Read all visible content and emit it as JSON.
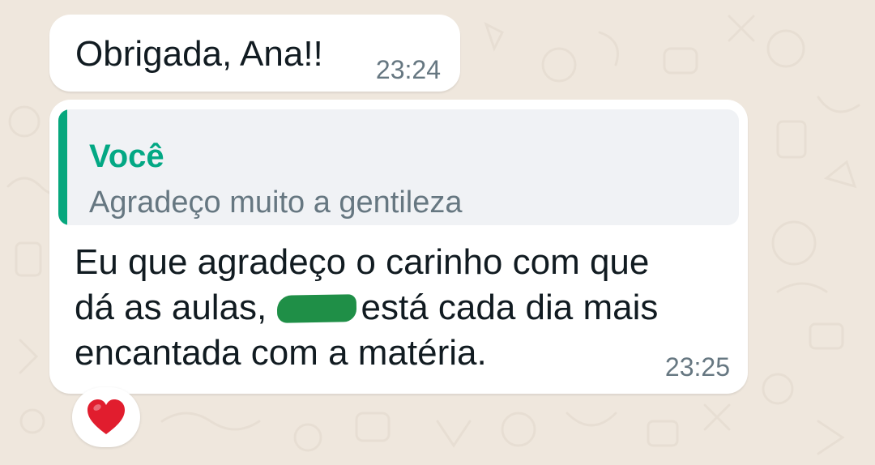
{
  "messages": [
    {
      "text": "Obrigada, Ana!!",
      "time": "23:24"
    },
    {
      "quote": {
        "author": "Você",
        "text": "Agradeço muito a gentileza"
      },
      "text_line1": "Eu que agradeço o carinho com que",
      "text_line2_before": "dá as aulas,",
      "text_line2_after": "está cada dia mais",
      "text_line3": "encantada com a matéria.",
      "time": "23:25",
      "reaction": "heart-icon"
    }
  ],
  "colors": {
    "wallpaper": "#efe7dd",
    "bubble": "#ffffff",
    "quote_accent": "#06a77d",
    "quote_author": "#03a884",
    "meta_text": "#667781",
    "redaction": "#1f8f47",
    "heart": "#e11d2e"
  }
}
